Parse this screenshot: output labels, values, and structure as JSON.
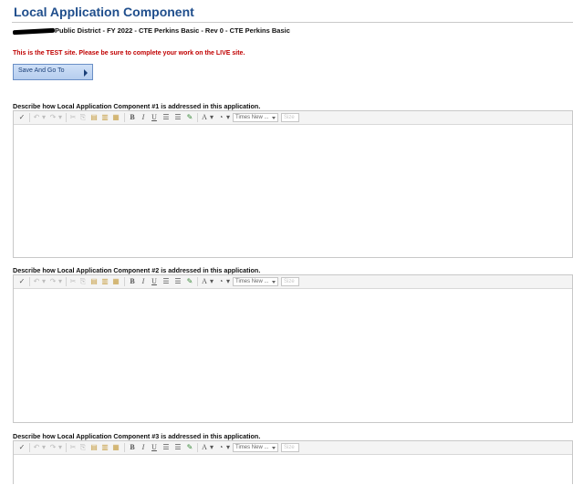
{
  "page": {
    "title": "Local Application Component",
    "district_line": "Public District - FY 2022 - CTE Perkins Basic - Rev 0 - CTE Perkins Basic",
    "test_warning": "This is the TEST site. Please be sure to complete your work on the LIVE site.",
    "save_button_label": "Save And Go To"
  },
  "toolbar": {
    "font_select": "Times New ...",
    "size_select": "Size"
  },
  "sections": [
    {
      "label": "Describe how Local Application Component #1 is addressed in this application."
    },
    {
      "label": "Describe how Local Application Component #2 is addressed in this application."
    },
    {
      "label": "Describe how Local Application Component #3 is addressed in this application."
    }
  ],
  "colors": {
    "title": "#1f4e8c",
    "warning": "#c00000",
    "button_bg": "#c3d7f2"
  }
}
